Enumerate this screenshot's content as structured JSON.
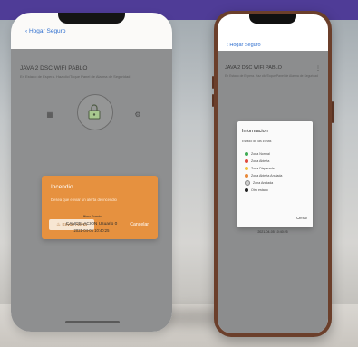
{
  "colors": {
    "band": "#4f3c97",
    "link": "#2f6fcf",
    "alert_bg": "#e6913f",
    "phone_frame": "#6b3f2b"
  },
  "left_phone": {
    "back_label": "Hogar Seguro",
    "title": "JAVA 2 DSC WIFI PABLO",
    "subtitle": "En Estado de Espera. Haz clic/Toque Panel de Alarma de Seguridad",
    "alert": {
      "title": "Incendio",
      "message": "Desea que enviar un alerta de incendio",
      "send_label": "Enviar Alerta",
      "cancel_label": "Cancelar"
    },
    "status_small": "Ultimo Evento",
    "event_label": "CANCELACION Usuario 0",
    "event_time": "2021-04-05 10:40:25"
  },
  "right_phone": {
    "back_label": "Hogar Seguro",
    "title": "JAVA 2 DSC WIFI PABLO",
    "subtitle": "En Estado de Espera. Haz clic/Toque Panel de Alarma de Seguridad",
    "dialog": {
      "title": "Informacion",
      "subtitle": "Estado de las zonas",
      "items": [
        {
          "label": "Zona Normal",
          "color": "#3faa55"
        },
        {
          "label": "Zona Abierta",
          "color": "#e04a3f"
        },
        {
          "label": "Zona Disparada",
          "color": "#f2c23c"
        },
        {
          "label": "Zona Abierta Anulada",
          "color": "#e8893a"
        },
        {
          "label": "Zona Anulada",
          "color": "#cfcfcf"
        },
        {
          "label": "Otro estado",
          "color": "#222222"
        }
      ],
      "close_label": "Cerrar"
    },
    "event_time": "2021-04-05 10:40:25"
  }
}
